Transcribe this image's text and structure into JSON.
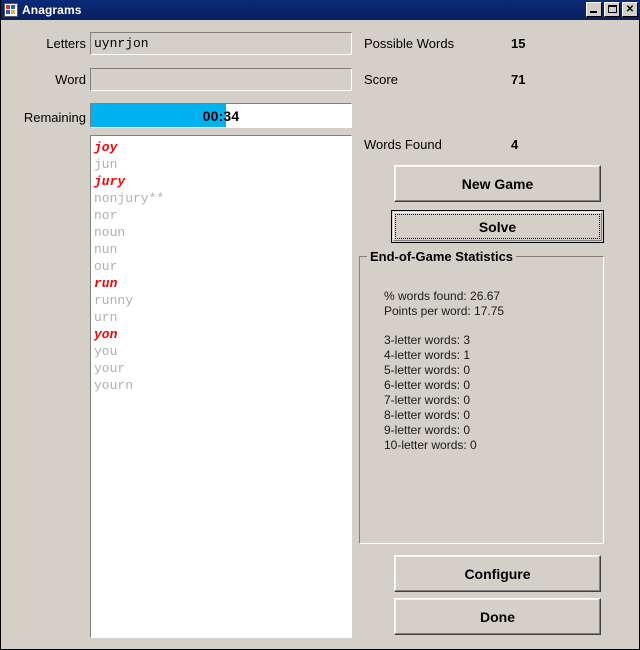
{
  "window": {
    "title": "Anagrams",
    "icon": "app-tiles-icon",
    "minimize_label": "Minimize",
    "maximize_label": "Maximize",
    "close_label": "Close",
    "close_glyph": "✕"
  },
  "form": {
    "letters_label": "Letters",
    "letters_value": "uynrjon",
    "word_label": "Word",
    "word_value": "",
    "remaining_label": "Remaining",
    "timer_text": "00:34",
    "timer_percent": 52
  },
  "stats_top": {
    "possible_words_label": "Possible Words",
    "possible_words_value": "15",
    "score_label": "Score",
    "score_value": "71",
    "words_found_label": "Words Found",
    "words_found_value": "4"
  },
  "buttons": {
    "new_game": "New Game",
    "solve": "Solve",
    "configure": "Configure",
    "done": "Done"
  },
  "word_list": [
    {
      "text": "joy",
      "found": true
    },
    {
      "text": "jun",
      "found": false
    },
    {
      "text": "jury",
      "found": true
    },
    {
      "text": "nonjury**",
      "found": false
    },
    {
      "text": "nor",
      "found": false
    },
    {
      "text": "noun",
      "found": false
    },
    {
      "text": "nun",
      "found": false
    },
    {
      "text": "our",
      "found": false
    },
    {
      "text": "run",
      "found": true
    },
    {
      "text": "runny",
      "found": false
    },
    {
      "text": "urn",
      "found": false
    },
    {
      "text": "yon",
      "found": true
    },
    {
      "text": "you",
      "found": false
    },
    {
      "text": "your",
      "found": false
    },
    {
      "text": "yourn",
      "found": false
    }
  ],
  "statistics": {
    "legend": "End-of-Game Statistics",
    "lines": [
      "% words found: 26.67",
      "Points per word: 17.75",
      "",
      "3-letter words: 3",
      "4-letter words: 1",
      "5-letter words: 0",
      "6-letter words: 0",
      "7-letter words: 0",
      "8-letter words: 0",
      "9-letter words: 0",
      "10-letter words: 0"
    ]
  },
  "colors": {
    "dialog_face": "#d4d0c8",
    "titlebar": "#0a246a",
    "progress_fill": "#00b2f0",
    "found_word": "#ff0000",
    "unfound_word": "#b0b0b0"
  }
}
